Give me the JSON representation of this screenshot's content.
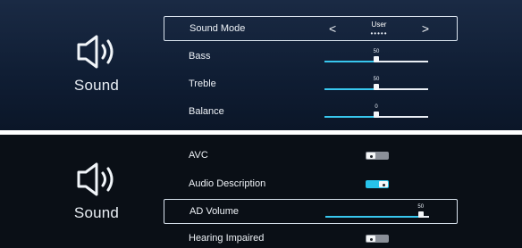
{
  "top_panel": {
    "category": {
      "label": "Sound",
      "icon": "speaker-icon"
    },
    "rows": [
      {
        "name": "Sound Mode",
        "type": "selector",
        "value": "User",
        "dots": "•••••",
        "left_arrow": "<",
        "right_arrow": ">",
        "selected": true
      },
      {
        "name": "Bass",
        "type": "slider",
        "value": "50",
        "level": 0.5
      },
      {
        "name": "Treble",
        "type": "slider",
        "value": "50",
        "level": 0.5
      },
      {
        "name": "Balance",
        "type": "slider",
        "value": "0",
        "level": 0.5
      }
    ]
  },
  "bottom_panel": {
    "category": {
      "label": "Sound",
      "icon": "speaker-icon"
    },
    "rows": [
      {
        "name": "AVC",
        "type": "toggle",
        "state": "off"
      },
      {
        "name": "Audio Description",
        "type": "toggle",
        "state": "on"
      },
      {
        "name": "AD Volume",
        "type": "slider",
        "value": "50",
        "level": 0.92,
        "selected": true
      },
      {
        "name": "Hearing Impaired",
        "type": "toggle",
        "state": "off"
      }
    ]
  },
  "colors": {
    "accent": "#38c7ee",
    "toggle_on": "#27c3ea",
    "toggle_off": "#8b9099"
  }
}
